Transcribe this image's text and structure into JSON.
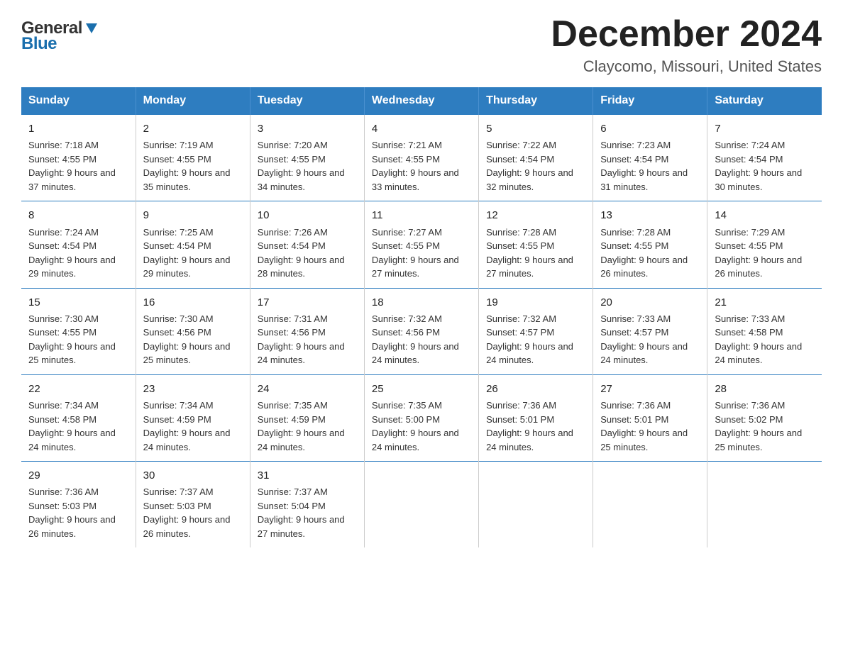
{
  "header": {
    "logo_general": "General",
    "logo_blue": "Blue",
    "title": "December 2024",
    "subtitle": "Claycomo, Missouri, United States"
  },
  "days_of_week": [
    "Sunday",
    "Monday",
    "Tuesday",
    "Wednesday",
    "Thursday",
    "Friday",
    "Saturday"
  ],
  "weeks": [
    [
      {
        "day": "1",
        "sunrise": "Sunrise: 7:18 AM",
        "sunset": "Sunset: 4:55 PM",
        "daylight": "Daylight: 9 hours and 37 minutes."
      },
      {
        "day": "2",
        "sunrise": "Sunrise: 7:19 AM",
        "sunset": "Sunset: 4:55 PM",
        "daylight": "Daylight: 9 hours and 35 minutes."
      },
      {
        "day": "3",
        "sunrise": "Sunrise: 7:20 AM",
        "sunset": "Sunset: 4:55 PM",
        "daylight": "Daylight: 9 hours and 34 minutes."
      },
      {
        "day": "4",
        "sunrise": "Sunrise: 7:21 AM",
        "sunset": "Sunset: 4:55 PM",
        "daylight": "Daylight: 9 hours and 33 minutes."
      },
      {
        "day": "5",
        "sunrise": "Sunrise: 7:22 AM",
        "sunset": "Sunset: 4:54 PM",
        "daylight": "Daylight: 9 hours and 32 minutes."
      },
      {
        "day": "6",
        "sunrise": "Sunrise: 7:23 AM",
        "sunset": "Sunset: 4:54 PM",
        "daylight": "Daylight: 9 hours and 31 minutes."
      },
      {
        "day": "7",
        "sunrise": "Sunrise: 7:24 AM",
        "sunset": "Sunset: 4:54 PM",
        "daylight": "Daylight: 9 hours and 30 minutes."
      }
    ],
    [
      {
        "day": "8",
        "sunrise": "Sunrise: 7:24 AM",
        "sunset": "Sunset: 4:54 PM",
        "daylight": "Daylight: 9 hours and 29 minutes."
      },
      {
        "day": "9",
        "sunrise": "Sunrise: 7:25 AM",
        "sunset": "Sunset: 4:54 PM",
        "daylight": "Daylight: 9 hours and 29 minutes."
      },
      {
        "day": "10",
        "sunrise": "Sunrise: 7:26 AM",
        "sunset": "Sunset: 4:54 PM",
        "daylight": "Daylight: 9 hours and 28 minutes."
      },
      {
        "day": "11",
        "sunrise": "Sunrise: 7:27 AM",
        "sunset": "Sunset: 4:55 PM",
        "daylight": "Daylight: 9 hours and 27 minutes."
      },
      {
        "day": "12",
        "sunrise": "Sunrise: 7:28 AM",
        "sunset": "Sunset: 4:55 PM",
        "daylight": "Daylight: 9 hours and 27 minutes."
      },
      {
        "day": "13",
        "sunrise": "Sunrise: 7:28 AM",
        "sunset": "Sunset: 4:55 PM",
        "daylight": "Daylight: 9 hours and 26 minutes."
      },
      {
        "day": "14",
        "sunrise": "Sunrise: 7:29 AM",
        "sunset": "Sunset: 4:55 PM",
        "daylight": "Daylight: 9 hours and 26 minutes."
      }
    ],
    [
      {
        "day": "15",
        "sunrise": "Sunrise: 7:30 AM",
        "sunset": "Sunset: 4:55 PM",
        "daylight": "Daylight: 9 hours and 25 minutes."
      },
      {
        "day": "16",
        "sunrise": "Sunrise: 7:30 AM",
        "sunset": "Sunset: 4:56 PM",
        "daylight": "Daylight: 9 hours and 25 minutes."
      },
      {
        "day": "17",
        "sunrise": "Sunrise: 7:31 AM",
        "sunset": "Sunset: 4:56 PM",
        "daylight": "Daylight: 9 hours and 24 minutes."
      },
      {
        "day": "18",
        "sunrise": "Sunrise: 7:32 AM",
        "sunset": "Sunset: 4:56 PM",
        "daylight": "Daylight: 9 hours and 24 minutes."
      },
      {
        "day": "19",
        "sunrise": "Sunrise: 7:32 AM",
        "sunset": "Sunset: 4:57 PM",
        "daylight": "Daylight: 9 hours and 24 minutes."
      },
      {
        "day": "20",
        "sunrise": "Sunrise: 7:33 AM",
        "sunset": "Sunset: 4:57 PM",
        "daylight": "Daylight: 9 hours and 24 minutes."
      },
      {
        "day": "21",
        "sunrise": "Sunrise: 7:33 AM",
        "sunset": "Sunset: 4:58 PM",
        "daylight": "Daylight: 9 hours and 24 minutes."
      }
    ],
    [
      {
        "day": "22",
        "sunrise": "Sunrise: 7:34 AM",
        "sunset": "Sunset: 4:58 PM",
        "daylight": "Daylight: 9 hours and 24 minutes."
      },
      {
        "day": "23",
        "sunrise": "Sunrise: 7:34 AM",
        "sunset": "Sunset: 4:59 PM",
        "daylight": "Daylight: 9 hours and 24 minutes."
      },
      {
        "day": "24",
        "sunrise": "Sunrise: 7:35 AM",
        "sunset": "Sunset: 4:59 PM",
        "daylight": "Daylight: 9 hours and 24 minutes."
      },
      {
        "day": "25",
        "sunrise": "Sunrise: 7:35 AM",
        "sunset": "Sunset: 5:00 PM",
        "daylight": "Daylight: 9 hours and 24 minutes."
      },
      {
        "day": "26",
        "sunrise": "Sunrise: 7:36 AM",
        "sunset": "Sunset: 5:01 PM",
        "daylight": "Daylight: 9 hours and 24 minutes."
      },
      {
        "day": "27",
        "sunrise": "Sunrise: 7:36 AM",
        "sunset": "Sunset: 5:01 PM",
        "daylight": "Daylight: 9 hours and 25 minutes."
      },
      {
        "day": "28",
        "sunrise": "Sunrise: 7:36 AM",
        "sunset": "Sunset: 5:02 PM",
        "daylight": "Daylight: 9 hours and 25 minutes."
      }
    ],
    [
      {
        "day": "29",
        "sunrise": "Sunrise: 7:36 AM",
        "sunset": "Sunset: 5:03 PM",
        "daylight": "Daylight: 9 hours and 26 minutes."
      },
      {
        "day": "30",
        "sunrise": "Sunrise: 7:37 AM",
        "sunset": "Sunset: 5:03 PM",
        "daylight": "Daylight: 9 hours and 26 minutes."
      },
      {
        "day": "31",
        "sunrise": "Sunrise: 7:37 AM",
        "sunset": "Sunset: 5:04 PM",
        "daylight": "Daylight: 9 hours and 27 minutes."
      },
      null,
      null,
      null,
      null
    ]
  ]
}
